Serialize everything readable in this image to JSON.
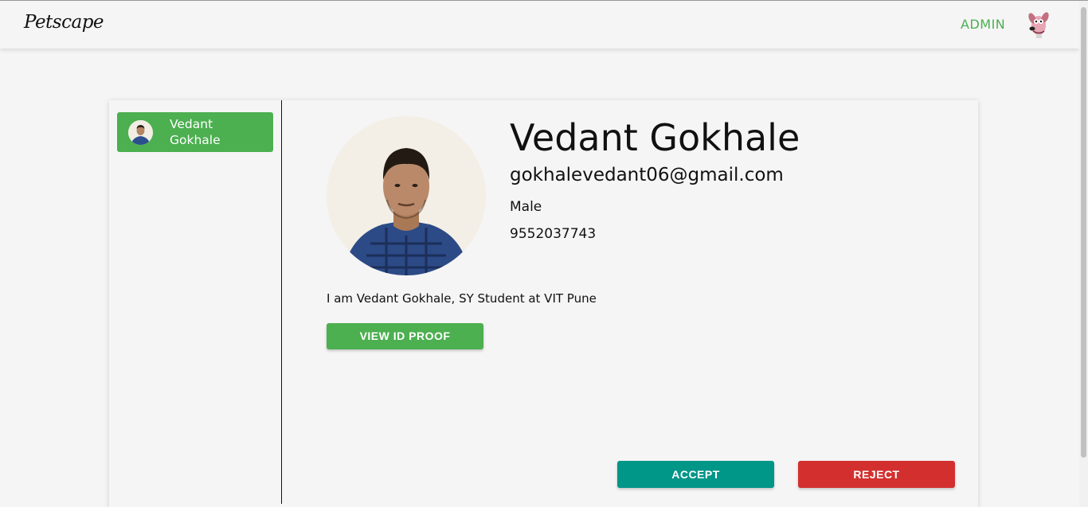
{
  "navbar": {
    "brand": "Petscape",
    "admin_label": "ADMIN",
    "avatar_icon": "cartoon-dog-avatar-icon"
  },
  "sidebar": {
    "users": [
      {
        "name": "Vedant Gokhale",
        "selected": true
      }
    ]
  },
  "profile": {
    "name": "Vedant Gokhale",
    "email": "gokhalevedant06@gmail.com",
    "gender": "Male",
    "phone": "9552037743",
    "bio": "I am Vedant Gokhale, SY Student at VIT Pune"
  },
  "actions": {
    "view_id_label": "VIEW ID PROOF",
    "accept_label": "ACCEPT",
    "reject_label": "REJECT"
  },
  "colors": {
    "green": "#4caf50",
    "teal": "#009688",
    "red": "#d32f2f"
  }
}
